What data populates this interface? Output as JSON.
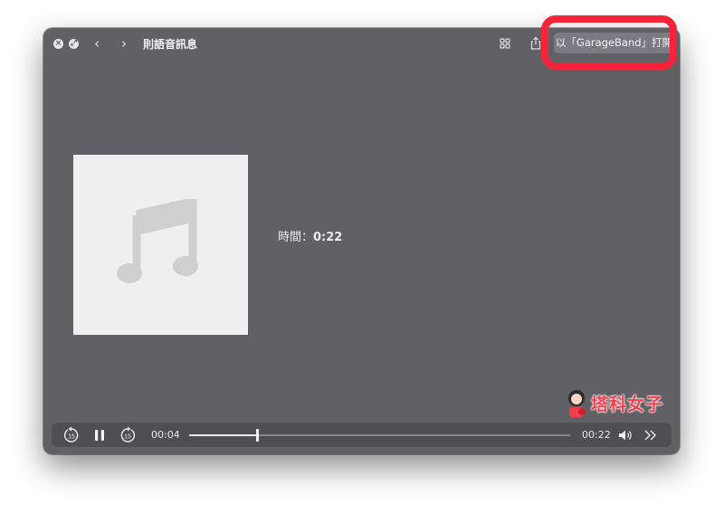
{
  "window": {
    "title": "則語音訊息",
    "open_with_label": "以「GarageBand」打開"
  },
  "media": {
    "duration_label": "時間：",
    "duration_value": "0:22"
  },
  "playback": {
    "current_time": "00:04",
    "total_time": "00:22",
    "progress_fraction": 0.18,
    "skip_back_seconds": "15",
    "skip_forward_seconds": "15",
    "state": "playing"
  },
  "watermark": {
    "text": "塔科女子"
  },
  "colors": {
    "window_bg": "#616065",
    "highlight": "#f5243a",
    "watermark": "#f43d4d"
  }
}
